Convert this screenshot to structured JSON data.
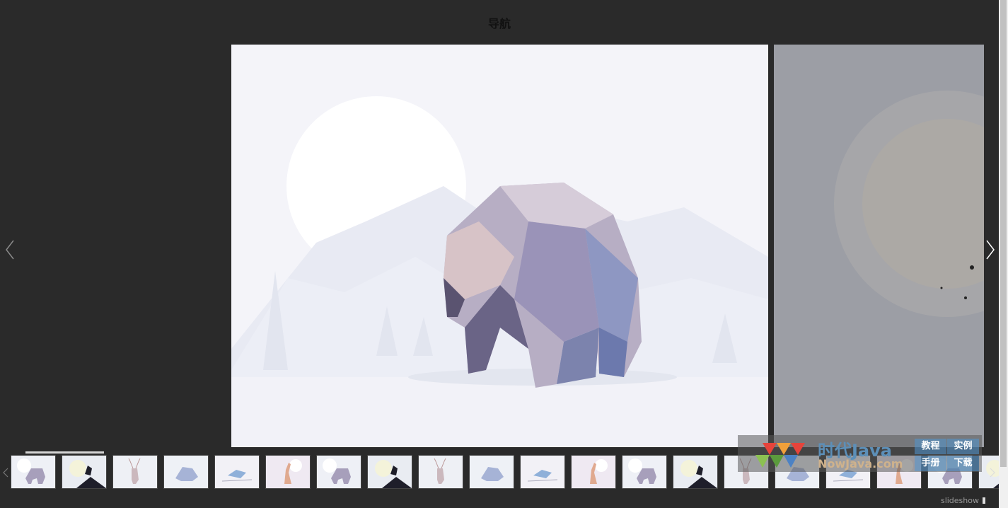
{
  "page": {
    "title": "导航"
  },
  "gallery": {
    "current_index": 0,
    "thumbnails": [
      {
        "subject": "bear"
      },
      {
        "subject": "crow"
      },
      {
        "subject": "deer"
      },
      {
        "subject": "fox"
      },
      {
        "subject": "bird"
      },
      {
        "subject": "giraffe"
      },
      {
        "subject": "bear"
      },
      {
        "subject": "crow"
      },
      {
        "subject": "deer"
      },
      {
        "subject": "fox"
      },
      {
        "subject": "bird"
      },
      {
        "subject": "giraffe"
      },
      {
        "subject": "bear"
      },
      {
        "subject": "crow"
      },
      {
        "subject": "deer"
      },
      {
        "subject": "fox"
      },
      {
        "subject": "bird"
      },
      {
        "subject": "giraffe"
      },
      {
        "subject": "bear"
      },
      {
        "subject": "crow"
      }
    ],
    "slideshow_label": "slideshow",
    "progress_fraction": 0.08
  },
  "watermark": {
    "brand": "时代Java",
    "domain": "NowJava.com",
    "links": [
      "教程",
      "实例",
      "手册",
      "下载"
    ]
  },
  "colors": {
    "background": "#2a2a2a",
    "slide_bg": "#f3f3f8"
  }
}
